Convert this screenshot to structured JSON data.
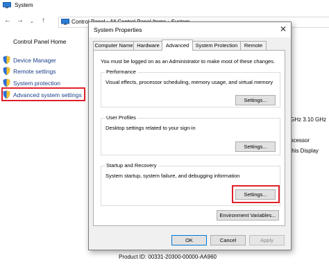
{
  "bg_window": {
    "title": "System",
    "address": "Control Panel › All Control Panel Items › System"
  },
  "left_pane": {
    "home": "Control Panel Home",
    "links": [
      {
        "label": "Device Manager"
      },
      {
        "label": "Remote settings"
      },
      {
        "label": "System protection"
      },
      {
        "label": "Advanced system settings"
      }
    ]
  },
  "bg_right": {
    "cpu_speed": "GHz  3.10 GHz",
    "processor": "ocessor",
    "display": "this Display",
    "product_id": "Product ID: 00331-20300-00000-AA960"
  },
  "dialog": {
    "title": "System Properties",
    "tabs": [
      {
        "label": "Computer Name"
      },
      {
        "label": "Hardware"
      },
      {
        "label": "Advanced"
      },
      {
        "label": "System Protection"
      },
      {
        "label": "Remote"
      }
    ],
    "active_tab": "Advanced",
    "admin_note": "You must be logged on as an Administrator to make most of these changes.",
    "groups": {
      "performance": {
        "title": "Performance",
        "desc": "Visual effects, processor scheduling, memory usage, and virtual memory",
        "button": "Settings..."
      },
      "user_profiles": {
        "title": "User Profiles",
        "desc": "Desktop settings related to your sign-in",
        "button": "Settings..."
      },
      "startup": {
        "title": "Startup and Recovery",
        "desc": "System startup, system failure, and debugging information",
        "button": "Settings..."
      }
    },
    "env_button": "Environment Variables...",
    "ok": "OK",
    "cancel": "Cancel",
    "apply": "Apply"
  },
  "colors": {
    "highlight": "#e0202a",
    "link": "#1a3f8a",
    "focus": "#0078d7"
  }
}
